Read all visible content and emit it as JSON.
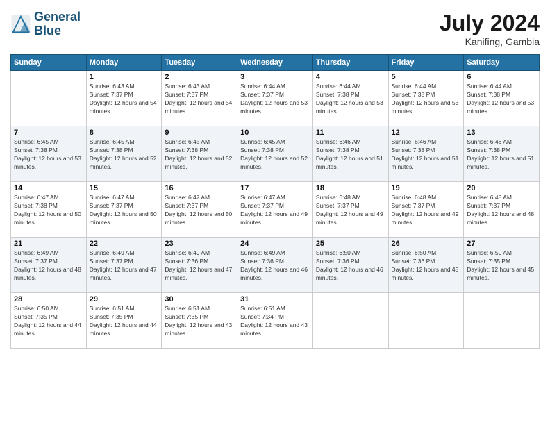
{
  "header": {
    "logo_line1": "General",
    "logo_line2": "Blue",
    "month_year": "July 2024",
    "location": "Kanifing, Gambia"
  },
  "days_of_week": [
    "Sunday",
    "Monday",
    "Tuesday",
    "Wednesday",
    "Thursday",
    "Friday",
    "Saturday"
  ],
  "weeks": [
    [
      {
        "day": "",
        "sunrise": "",
        "sunset": "",
        "daylight": ""
      },
      {
        "day": "1",
        "sunrise": "Sunrise: 6:43 AM",
        "sunset": "Sunset: 7:37 PM",
        "daylight": "Daylight: 12 hours and 54 minutes."
      },
      {
        "day": "2",
        "sunrise": "Sunrise: 6:43 AM",
        "sunset": "Sunset: 7:37 PM",
        "daylight": "Daylight: 12 hours and 54 minutes."
      },
      {
        "day": "3",
        "sunrise": "Sunrise: 6:44 AM",
        "sunset": "Sunset: 7:37 PM",
        "daylight": "Daylight: 12 hours and 53 minutes."
      },
      {
        "day": "4",
        "sunrise": "Sunrise: 6:44 AM",
        "sunset": "Sunset: 7:38 PM",
        "daylight": "Daylight: 12 hours and 53 minutes."
      },
      {
        "day": "5",
        "sunrise": "Sunrise: 6:44 AM",
        "sunset": "Sunset: 7:38 PM",
        "daylight": "Daylight: 12 hours and 53 minutes."
      },
      {
        "day": "6",
        "sunrise": "Sunrise: 6:44 AM",
        "sunset": "Sunset: 7:38 PM",
        "daylight": "Daylight: 12 hours and 53 minutes."
      }
    ],
    [
      {
        "day": "7",
        "sunrise": "Sunrise: 6:45 AM",
        "sunset": "Sunset: 7:38 PM",
        "daylight": "Daylight: 12 hours and 53 minutes."
      },
      {
        "day": "8",
        "sunrise": "Sunrise: 6:45 AM",
        "sunset": "Sunset: 7:38 PM",
        "daylight": "Daylight: 12 hours and 52 minutes."
      },
      {
        "day": "9",
        "sunrise": "Sunrise: 6:45 AM",
        "sunset": "Sunset: 7:38 PM",
        "daylight": "Daylight: 12 hours and 52 minutes."
      },
      {
        "day": "10",
        "sunrise": "Sunrise: 6:45 AM",
        "sunset": "Sunset: 7:38 PM",
        "daylight": "Daylight: 12 hours and 52 minutes."
      },
      {
        "day": "11",
        "sunrise": "Sunrise: 6:46 AM",
        "sunset": "Sunset: 7:38 PM",
        "daylight": "Daylight: 12 hours and 51 minutes."
      },
      {
        "day": "12",
        "sunrise": "Sunrise: 6:46 AM",
        "sunset": "Sunset: 7:38 PM",
        "daylight": "Daylight: 12 hours and 51 minutes."
      },
      {
        "day": "13",
        "sunrise": "Sunrise: 6:46 AM",
        "sunset": "Sunset: 7:38 PM",
        "daylight": "Daylight: 12 hours and 51 minutes."
      }
    ],
    [
      {
        "day": "14",
        "sunrise": "Sunrise: 6:47 AM",
        "sunset": "Sunset: 7:38 PM",
        "daylight": "Daylight: 12 hours and 50 minutes."
      },
      {
        "day": "15",
        "sunrise": "Sunrise: 6:47 AM",
        "sunset": "Sunset: 7:37 PM",
        "daylight": "Daylight: 12 hours and 50 minutes."
      },
      {
        "day": "16",
        "sunrise": "Sunrise: 6:47 AM",
        "sunset": "Sunset: 7:37 PM",
        "daylight": "Daylight: 12 hours and 50 minutes."
      },
      {
        "day": "17",
        "sunrise": "Sunrise: 6:47 AM",
        "sunset": "Sunset: 7:37 PM",
        "daylight": "Daylight: 12 hours and 49 minutes."
      },
      {
        "day": "18",
        "sunrise": "Sunrise: 6:48 AM",
        "sunset": "Sunset: 7:37 PM",
        "daylight": "Daylight: 12 hours and 49 minutes."
      },
      {
        "day": "19",
        "sunrise": "Sunrise: 6:48 AM",
        "sunset": "Sunset: 7:37 PM",
        "daylight": "Daylight: 12 hours and 49 minutes."
      },
      {
        "day": "20",
        "sunrise": "Sunrise: 6:48 AM",
        "sunset": "Sunset: 7:37 PM",
        "daylight": "Daylight: 12 hours and 48 minutes."
      }
    ],
    [
      {
        "day": "21",
        "sunrise": "Sunrise: 6:49 AM",
        "sunset": "Sunset: 7:37 PM",
        "daylight": "Daylight: 12 hours and 48 minutes."
      },
      {
        "day": "22",
        "sunrise": "Sunrise: 6:49 AM",
        "sunset": "Sunset: 7:37 PM",
        "daylight": "Daylight: 12 hours and 47 minutes."
      },
      {
        "day": "23",
        "sunrise": "Sunrise: 6:49 AM",
        "sunset": "Sunset: 7:36 PM",
        "daylight": "Daylight: 12 hours and 47 minutes."
      },
      {
        "day": "24",
        "sunrise": "Sunrise: 6:49 AM",
        "sunset": "Sunset: 7:36 PM",
        "daylight": "Daylight: 12 hours and 46 minutes."
      },
      {
        "day": "25",
        "sunrise": "Sunrise: 6:50 AM",
        "sunset": "Sunset: 7:36 PM",
        "daylight": "Daylight: 12 hours and 46 minutes."
      },
      {
        "day": "26",
        "sunrise": "Sunrise: 6:50 AM",
        "sunset": "Sunset: 7:36 PM",
        "daylight": "Daylight: 12 hours and 45 minutes."
      },
      {
        "day": "27",
        "sunrise": "Sunrise: 6:50 AM",
        "sunset": "Sunset: 7:35 PM",
        "daylight": "Daylight: 12 hours and 45 minutes."
      }
    ],
    [
      {
        "day": "28",
        "sunrise": "Sunrise: 6:50 AM",
        "sunset": "Sunset: 7:35 PM",
        "daylight": "Daylight: 12 hours and 44 minutes."
      },
      {
        "day": "29",
        "sunrise": "Sunrise: 6:51 AM",
        "sunset": "Sunset: 7:35 PM",
        "daylight": "Daylight: 12 hours and 44 minutes."
      },
      {
        "day": "30",
        "sunrise": "Sunrise: 6:51 AM",
        "sunset": "Sunset: 7:35 PM",
        "daylight": "Daylight: 12 hours and 43 minutes."
      },
      {
        "day": "31",
        "sunrise": "Sunrise: 6:51 AM",
        "sunset": "Sunset: 7:34 PM",
        "daylight": "Daylight: 12 hours and 43 minutes."
      },
      {
        "day": "",
        "sunrise": "",
        "sunset": "",
        "daylight": ""
      },
      {
        "day": "",
        "sunrise": "",
        "sunset": "",
        "daylight": ""
      },
      {
        "day": "",
        "sunrise": "",
        "sunset": "",
        "daylight": ""
      }
    ]
  ]
}
